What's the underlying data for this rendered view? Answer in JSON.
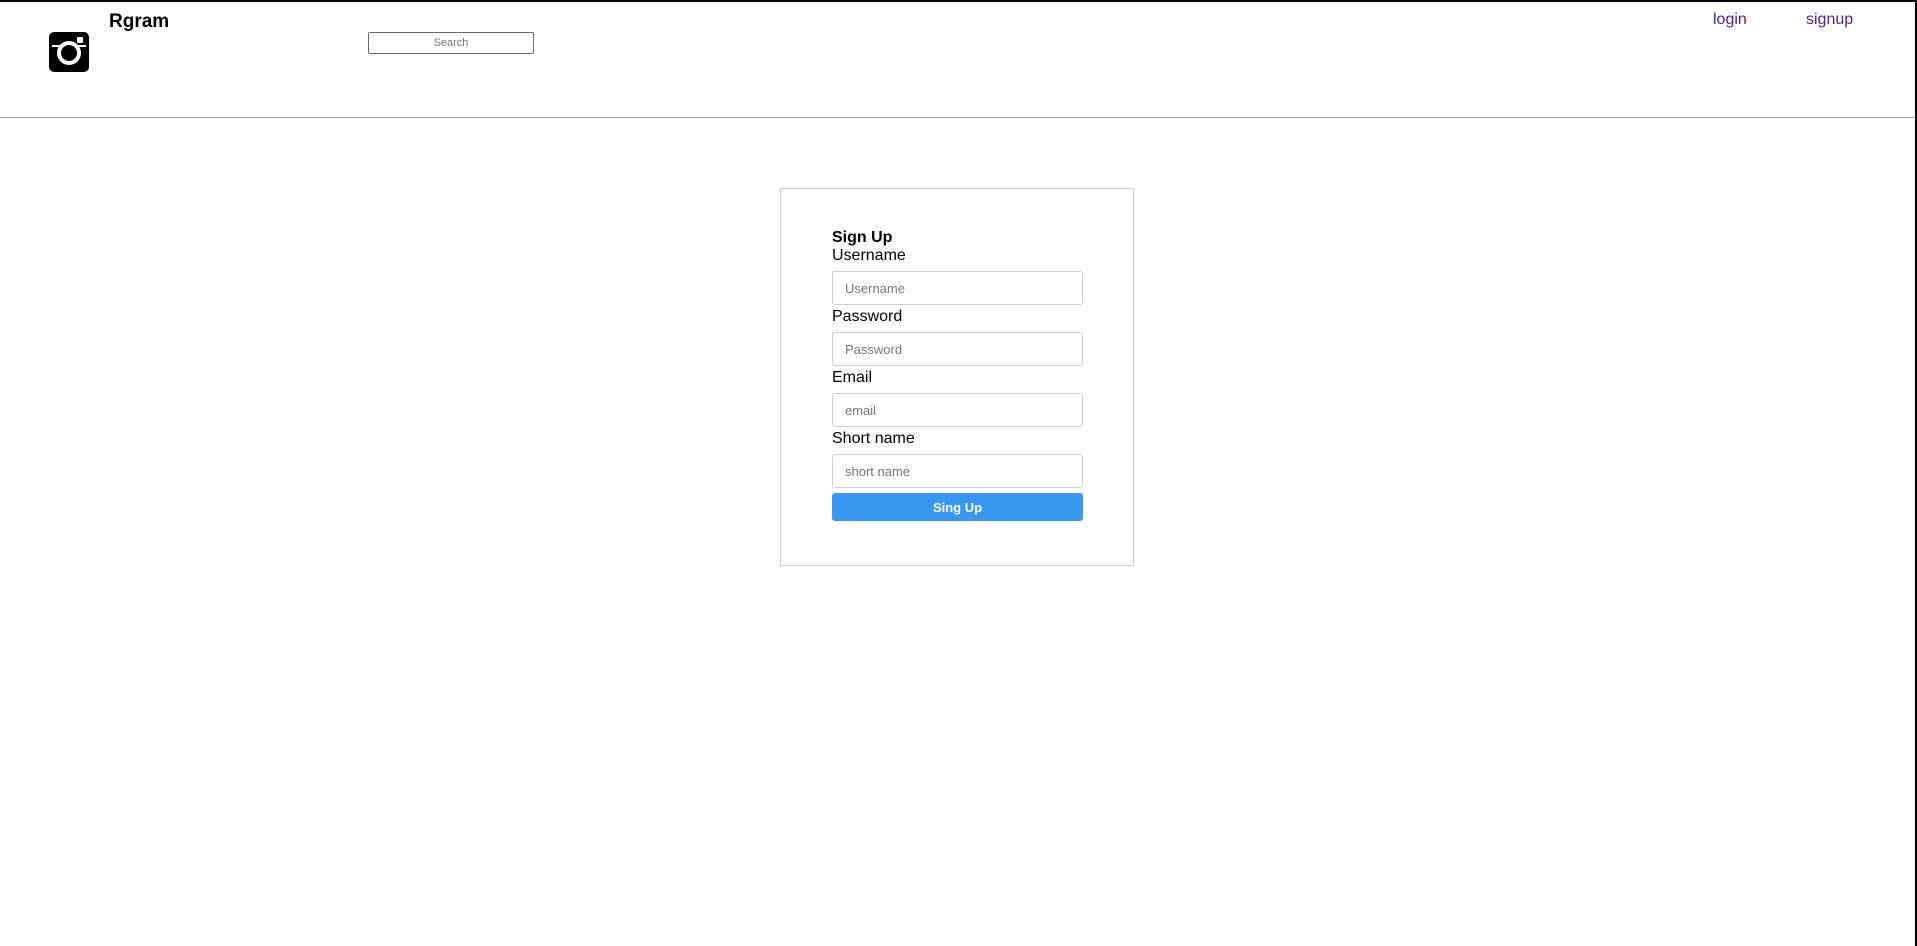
{
  "header": {
    "brand": "Rgram",
    "logo_icon": "camera-icon",
    "search_placeholder": "Search",
    "nav": {
      "login": "login",
      "signup": "signup"
    },
    "link_color": "#551a8b"
  },
  "signup_form": {
    "title": "Sign Up",
    "fields": [
      {
        "label": "Username",
        "placeholder": "Username",
        "value": ""
      },
      {
        "label": "Password",
        "placeholder": "Password",
        "value": ""
      },
      {
        "label": "Email",
        "placeholder": "email",
        "value": ""
      },
      {
        "label": "Short name",
        "placeholder": "short name",
        "value": ""
      }
    ],
    "submit_label": "Sing Up",
    "accent_color": "#3897f0"
  }
}
